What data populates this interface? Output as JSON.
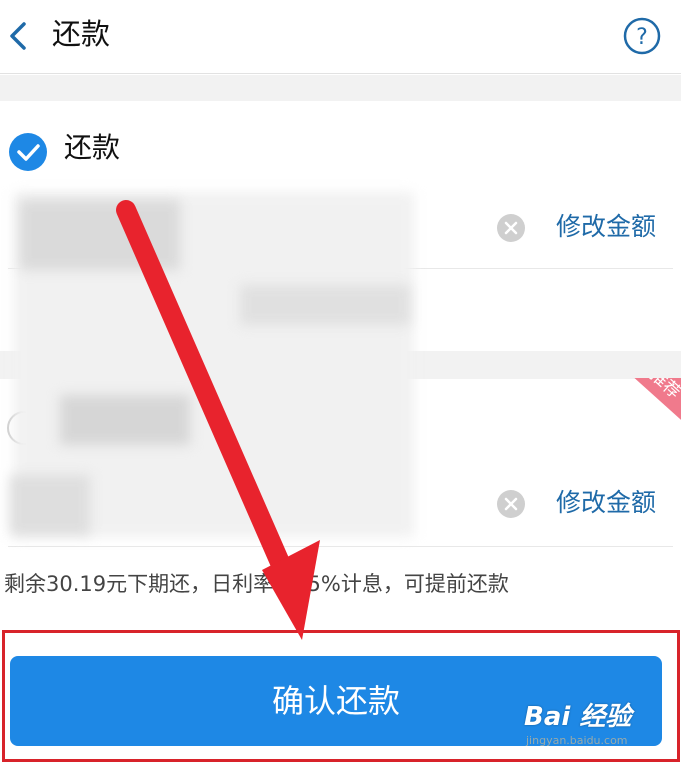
{
  "header": {
    "back_icon": "chevron-left-icon",
    "title": "还款",
    "help_icon": "question-circle-icon"
  },
  "option1": {
    "checked": true,
    "label": "还款",
    "modify_label": "修改金额",
    "clear_icon": "clear-circle-icon"
  },
  "option2": {
    "tag": "推荐",
    "modify_label": "修改金额",
    "clear_icon": "clear-circle-icon"
  },
  "note": "剩余30.19元下期还，日利率0.05%计息，可提前还款",
  "confirm_button": "确认还款",
  "watermark": {
    "brand": "Bai 经验",
    "url": "jingyan.baidu.com"
  },
  "colors": {
    "accent": "#1e88e5",
    "link": "#1f6aa8",
    "annotation_red": "#d8232a",
    "tag_pink": "#f07a8c"
  }
}
